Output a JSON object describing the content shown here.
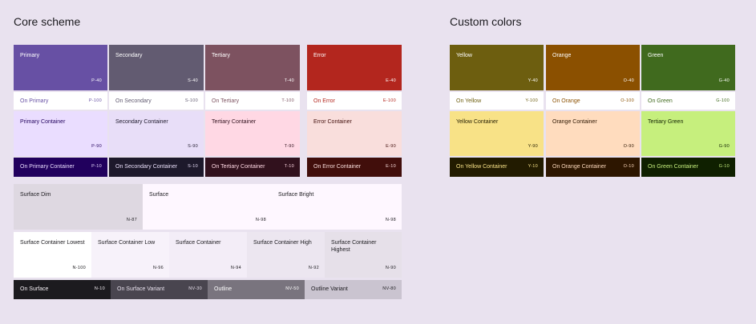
{
  "core": {
    "title": "Core scheme",
    "primary": {
      "label": "Primary",
      "token": "P-40"
    },
    "secondary": {
      "label": "Secondary",
      "token": "S-40"
    },
    "tertiary": {
      "label": "Tertiary",
      "token": "T-40"
    },
    "error": {
      "label": "Error",
      "token": "E-40"
    },
    "on_primary": {
      "label": "On Primary",
      "token": "P-100"
    },
    "on_secondary": {
      "label": "On Secondary",
      "token": "S-100"
    },
    "on_tertiary": {
      "label": "On Tertiary",
      "token": "T-100"
    },
    "on_error": {
      "label": "On Error",
      "token": "E-100"
    },
    "primary_container": {
      "label": "Primary Container",
      "token": "P-90"
    },
    "secondary_container": {
      "label": "Secondary Container",
      "token": "S-90"
    },
    "tertiary_container": {
      "label": "Tertiary Container",
      "token": "T-90"
    },
    "error_container": {
      "label": "Error Container",
      "token": "E-90"
    },
    "on_primary_container": {
      "label": "On Primary Container",
      "token": "P-10"
    },
    "on_secondary_container": {
      "label": "On Secondary Container",
      "token": "S-10"
    },
    "on_tertiary_container": {
      "label": "On Tertiary Container",
      "token": "T-10"
    },
    "on_error_container": {
      "label": "On Error Container",
      "token": "E-10"
    },
    "surface_dim": {
      "label": "Surface Dim",
      "token": "N-87"
    },
    "surface": {
      "label": "Surface",
      "token": "N-98"
    },
    "surface_bright": {
      "label": "Surface Bright",
      "token": "N-98"
    },
    "sc_lowest": {
      "label": "Surface Container Lowest",
      "token": "N-100"
    },
    "sc_low": {
      "label": "Surface Container Low",
      "token": "N-96"
    },
    "sc": {
      "label": "Surface Container",
      "token": "N-94"
    },
    "sc_high": {
      "label": "Surface Container High",
      "token": "N-92"
    },
    "sc_highest": {
      "label": "Surface Container Highest",
      "token": "N-90"
    },
    "on_surface": {
      "label": "On Surface",
      "token": "N-10"
    },
    "on_surface_variant": {
      "label": "On Surface Variant",
      "token": "NV-30"
    },
    "outline": {
      "label": "Outline",
      "token": "NV-50"
    },
    "outline_variant": {
      "label": "Outline Variant",
      "token": "NV-80"
    }
  },
  "custom": {
    "title": "Custom colors",
    "yellow": {
      "label": "Yellow",
      "token": "Y-40"
    },
    "orange": {
      "label": "Orange",
      "token": "O-40"
    },
    "green": {
      "label": "Green",
      "token": "G-40"
    },
    "on_yellow": {
      "label": "On Yellow",
      "token": "Y-100"
    },
    "on_orange": {
      "label": "On Orange",
      "token": "O-100"
    },
    "on_green": {
      "label": "On Green",
      "token": "G-100"
    },
    "yellow_container": {
      "label": "Yellow Container",
      "token": "Y-90"
    },
    "orange_container": {
      "label": "Orange Container",
      "token": "O-90"
    },
    "tertiary_green": {
      "label": "Tertiary Green",
      "token": "G-90"
    },
    "on_yellow_container": {
      "label": "On Yellow Container",
      "token": "Y-10"
    },
    "on_orange_container": {
      "label": "On Orange Container",
      "token": "O-10"
    },
    "on_green_container": {
      "label": "On Green Container",
      "token": "G-10"
    }
  },
  "colors": {
    "background": "#e9e2ef",
    "primary": "#6750a4",
    "secondary": "#625b71",
    "tertiary": "#7d5260",
    "error": "#b3261e",
    "primary_container": "#eaddff",
    "secondary_container": "#e8def8",
    "tertiary_container": "#ffd8e4",
    "error_container": "#f9dedc",
    "on_primary_container": "#21005d",
    "on_secondary_container": "#1d192b",
    "on_tertiary_container": "#31111d",
    "on_error_container": "#410e0b",
    "yellow": "#6d5e0f",
    "orange": "#8b5000",
    "green": "#406a1e",
    "yellow_container": "#f8e287",
    "orange_container": "#ffdcbe",
    "tertiary_green": "#c6ef7d",
    "on_yellow_container": "#221b00",
    "on_orange_container": "#2d1600",
    "on_green_container": "#0f2000"
  }
}
